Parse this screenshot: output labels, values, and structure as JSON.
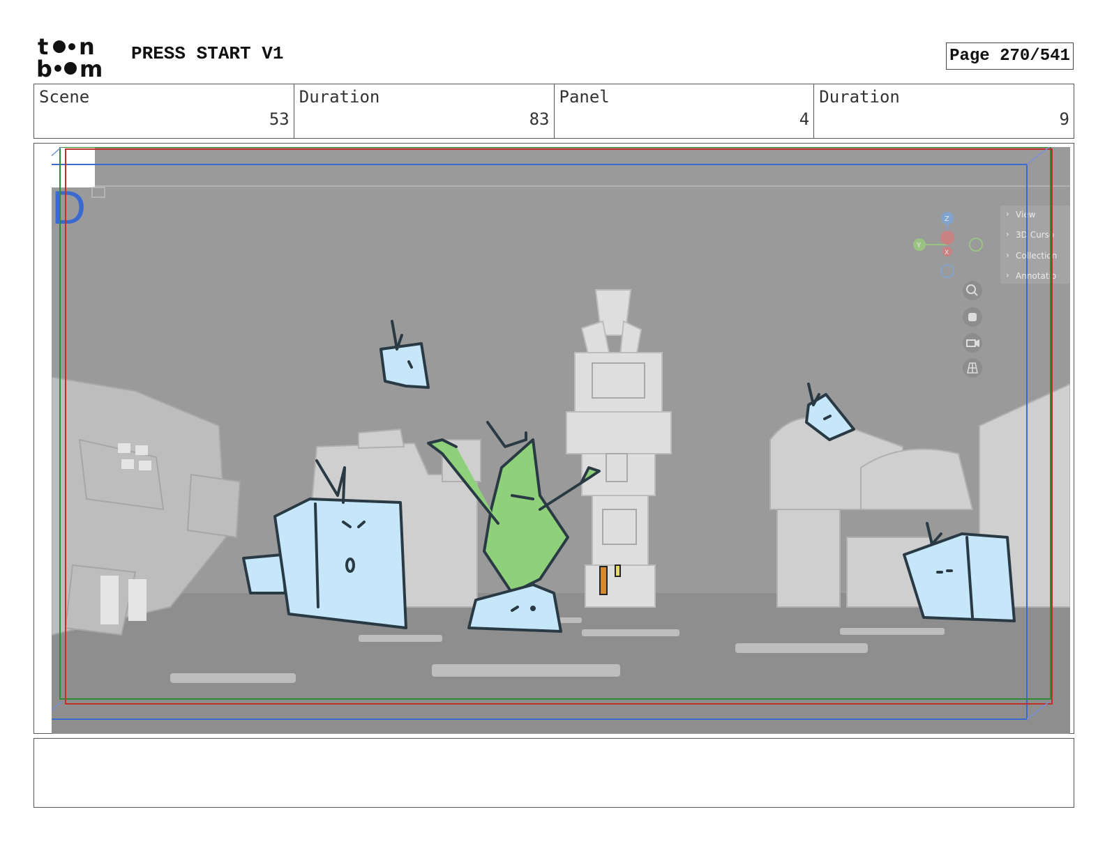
{
  "header": {
    "logo_text": "toon boom",
    "project_title": "PRESS START V1",
    "page_label": "Page 270/541"
  },
  "info": {
    "scene_label": "Scene",
    "scene_value": "53",
    "scene_duration_label": "Duration",
    "scene_duration_value": "83",
    "panel_label": "Panel",
    "panel_value": "4",
    "panel_duration_label": "Duration",
    "panel_duration_value": "9"
  },
  "panel": {
    "layer_letter": "D",
    "viewport_menu": [
      "View",
      "3D Curso",
      "Collection",
      "Annotatio"
    ],
    "gizmo_axes": [
      "Z",
      "Y",
      "X"
    ],
    "colors": {
      "background": "#9a9a9a",
      "building": "#d8d8d8",
      "cube_fill": "#c6e6fa",
      "rabbit_fill": "#8fd07a",
      "ink": "#2a3a44",
      "safe_red": "#c0302a",
      "safe_green": "#2f8a35",
      "safe_blue": "#3a6ad0"
    }
  },
  "notes": {
    "text": ""
  }
}
